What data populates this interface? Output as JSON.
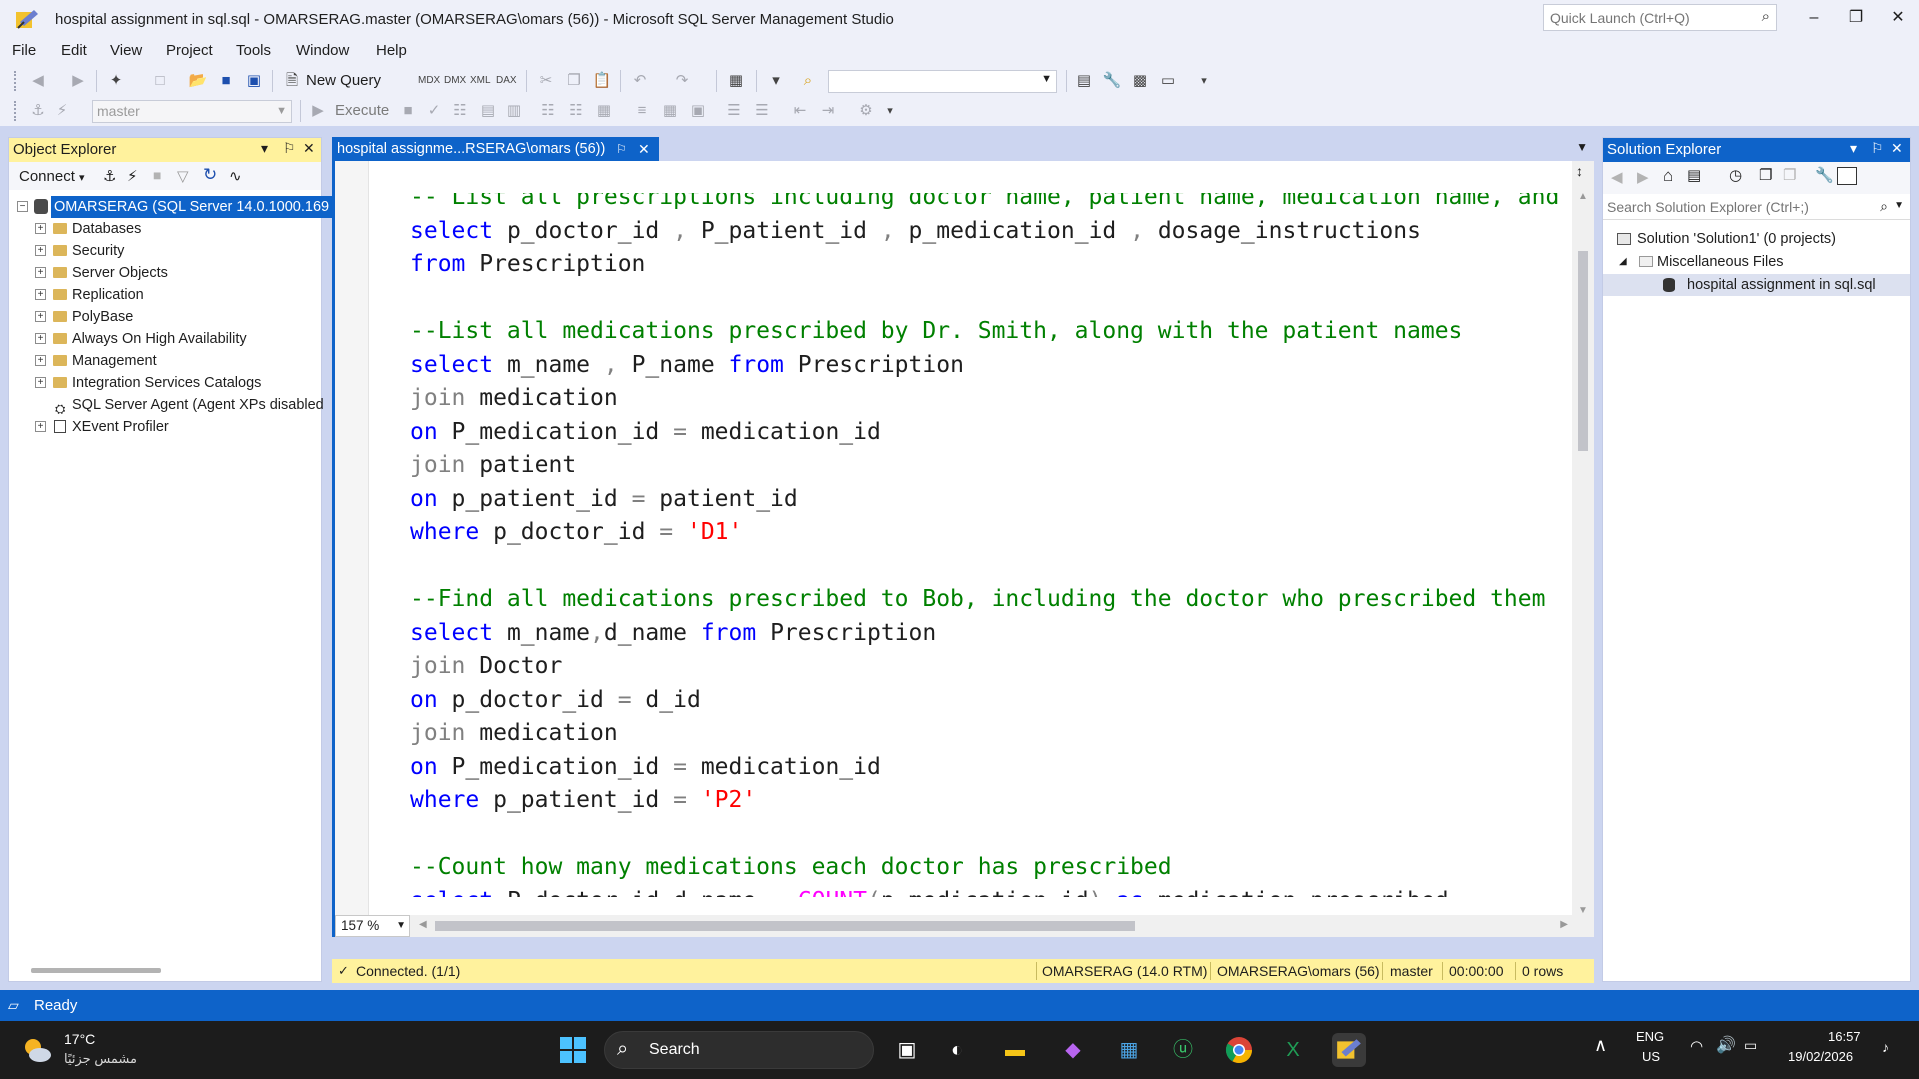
{
  "window": {
    "title": "hospital assignment in sql.sql - OMARSERAG.master (OMARSERAG\\omars (56)) - Microsoft SQL Server Management Studio",
    "quick_launch_placeholder": "Quick Launch (Ctrl+Q)"
  },
  "menu": [
    "File",
    "Edit",
    "View",
    "Project",
    "Tools",
    "Window",
    "Help"
  ],
  "toolbar": {
    "new_query": "New Query",
    "execute": "Execute",
    "database": "master"
  },
  "object_explorer": {
    "title": "Object Explorer",
    "connect": "Connect",
    "tree": [
      {
        "label": "OMARSERAG (SQL Server 14.0.1000.169",
        "level": 0,
        "selected": true,
        "expander": "minus"
      },
      {
        "label": "Databases",
        "level": 1,
        "expander": "plus"
      },
      {
        "label": "Security",
        "level": 1,
        "expander": "plus"
      },
      {
        "label": "Server Objects",
        "level": 1,
        "expander": "plus"
      },
      {
        "label": "Replication",
        "level": 1,
        "expander": "plus"
      },
      {
        "label": "PolyBase",
        "level": 1,
        "expander": "plus"
      },
      {
        "label": "Always On High Availability",
        "level": 1,
        "expander": "plus"
      },
      {
        "label": "Management",
        "level": 1,
        "expander": "plus"
      },
      {
        "label": "Integration Services Catalogs",
        "level": 1,
        "expander": "plus"
      },
      {
        "label": "SQL Server Agent (Agent XPs disabled",
        "level": 1,
        "expander": "none"
      },
      {
        "label": "XEvent Profiler",
        "level": 1,
        "expander": "plus"
      }
    ]
  },
  "editor": {
    "tab_title": "hospital assignme...RSERAG\\omars (56))",
    "zoom": "157 %",
    "code_lines": [
      [
        [
          "cm",
          "-- List all prescriptions including doctor name, patient name, medication name, and"
        ]
      ],
      [
        [
          "kw",
          "select"
        ],
        [
          "id",
          " p_doctor_id "
        ],
        [
          "gr",
          ","
        ],
        [
          "id",
          " P_patient_id "
        ],
        [
          "gr",
          ","
        ],
        [
          "id",
          " p_medication_id "
        ],
        [
          "gr",
          ","
        ],
        [
          "id",
          " dosage_instructions"
        ]
      ],
      [
        [
          "kw",
          "from"
        ],
        [
          "id",
          " Prescription"
        ]
      ],
      [],
      [
        [
          "cm",
          "--List all medications prescribed by Dr. Smith, along with the patient names"
        ]
      ],
      [
        [
          "kw",
          "select"
        ],
        [
          "id",
          " m_name "
        ],
        [
          "gr",
          ","
        ],
        [
          "id",
          " P_name "
        ],
        [
          "kw",
          "from"
        ],
        [
          "id",
          " Prescription"
        ]
      ],
      [
        [
          "gr",
          "join"
        ],
        [
          "id",
          " medication"
        ]
      ],
      [
        [
          "kw",
          "on"
        ],
        [
          "id",
          " P_medication_id "
        ],
        [
          "gr",
          "="
        ],
        [
          "id",
          " medication_id"
        ]
      ],
      [
        [
          "gr",
          "join"
        ],
        [
          "id",
          " patient"
        ]
      ],
      [
        [
          "kw",
          "on"
        ],
        [
          "id",
          " p_patient_id "
        ],
        [
          "gr",
          "="
        ],
        [
          "id",
          " patient_id"
        ]
      ],
      [
        [
          "kw",
          "where"
        ],
        [
          "id",
          " p_doctor_id "
        ],
        [
          "gr",
          "="
        ],
        [
          "str",
          " 'D1'"
        ]
      ],
      [],
      [
        [
          "cm",
          "--Find all medications prescribed to Bob, including the doctor who prescribed them"
        ]
      ],
      [
        [
          "kw",
          "select"
        ],
        [
          "id",
          " m_name"
        ],
        [
          "gr",
          ","
        ],
        [
          "id",
          "d_name "
        ],
        [
          "kw",
          "from"
        ],
        [
          "id",
          " Prescription"
        ]
      ],
      [
        [
          "gr",
          "join"
        ],
        [
          "id",
          " Doctor"
        ]
      ],
      [
        [
          "kw",
          "on"
        ],
        [
          "id",
          " p_doctor_id "
        ],
        [
          "gr",
          "="
        ],
        [
          "id",
          " d_id"
        ]
      ],
      [
        [
          "gr",
          "join"
        ],
        [
          "id",
          " medication"
        ]
      ],
      [
        [
          "kw",
          "on"
        ],
        [
          "id",
          " P_medication_id "
        ],
        [
          "gr",
          "="
        ],
        [
          "id",
          " medication_id"
        ]
      ],
      [
        [
          "kw",
          "where"
        ],
        [
          "id",
          " p_patient_id "
        ],
        [
          "gr",
          "="
        ],
        [
          "str",
          " 'P2'"
        ]
      ],
      [],
      [
        [
          "cm",
          "--Count how many medications each doctor has prescribed"
        ]
      ],
      [
        [
          "kw",
          "select"
        ],
        [
          "id",
          " P_doctor_id"
        ],
        [
          "gr",
          ","
        ],
        [
          "id",
          "d_name "
        ],
        [
          "gr",
          ","
        ],
        [
          "fn",
          " COUNT"
        ],
        [
          "gr",
          "("
        ],
        [
          "id",
          "p_medication_id"
        ],
        [
          "gr",
          ")"
        ],
        [
          "kw",
          " as"
        ],
        [
          "id",
          " medication_prescribed"
        ]
      ]
    ]
  },
  "connection_bar": {
    "status": "Connected. (1/1)",
    "server": "OMARSERAG (14.0 RTM)",
    "user": "OMARSERAG\\omars (56)",
    "database": "master",
    "elapsed": "00:00:00",
    "rows": "0 rows"
  },
  "solution_explorer": {
    "title": "Solution Explorer",
    "search_placeholder": "Search Solution Explorer (Ctrl+;)",
    "solution": "Solution 'Solution1' (0 projects)",
    "misc_folder": "Miscellaneous Files",
    "file": "hospital assignment in sql.sql"
  },
  "statusbar": {
    "text": "Ready"
  },
  "taskbar": {
    "weather_temp": "17°C",
    "weather_desc": "مشمس جزئيًا",
    "search": "Search",
    "lang": "ENG",
    "region": "US",
    "time": "16:57",
    "date": "19/02/2026"
  },
  "colors": {
    "accent": "#0e63c9",
    "highlight": "#fff29d",
    "comment": "#008000",
    "keyword": "#0000ff",
    "string": "#ff0000",
    "function": "#ff00ff"
  }
}
